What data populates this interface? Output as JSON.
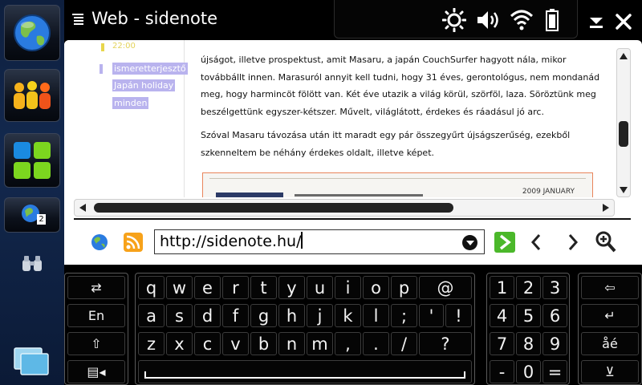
{
  "window": {
    "title": "Web - sidenote"
  },
  "sidebar": {
    "task_count": "2"
  },
  "content": {
    "cut_text": "22:00",
    "highlights": [
      "ismeretterjesztő",
      "Japán holiday",
      "minden"
    ],
    "paragraphs": [
      "újságot, illetve prospektust, amit Masaru, a japán CouchSurfer hagyott nála, mikor továbbállt innen. Marasuról annyit kell tudni, hogy 31 éves, gerontológus, nem mondanád meg, hogy harmincöt fölött van. Két éve utazik a világ körül, szörföl, laza. Söröztünk meg beszélgettünk egyszer-kétszer. Művelt, világlátott, érdekes és ráadásul jó arc.",
      "Szóval Masaru távozása után itt maradt egy pár összegyűrt újságszerűség, ezekből szkenneltem be néhány érdekes oldalt, illetve képet."
    ],
    "scan_date": "2009 JANUARY"
  },
  "urlbar": {
    "url": "http://sidenote.hu/"
  },
  "keyboard": {
    "left_keys": [
      "⇄",
      "En",
      "⇧",
      "▤◂"
    ],
    "letter_rows": [
      [
        "q",
        "w",
        "e",
        "r",
        "t",
        "y",
        "u",
        "i",
        "o",
        "p",
        "@"
      ],
      [
        "a",
        "s",
        "d",
        "f",
        "g",
        "h",
        "j",
        "k",
        "l",
        ";",
        "'",
        "!"
      ],
      [
        "z",
        "x",
        "c",
        "v",
        "b",
        "n",
        "m",
        ",",
        ".",
        "/",
        "?"
      ]
    ],
    "num_rows": [
      [
        "1",
        "2",
        "3"
      ],
      [
        "4",
        "5",
        "6"
      ],
      [
        "7",
        "8",
        "9"
      ],
      [
        "-",
        "0",
        "="
      ]
    ],
    "right_keys": [
      "⇦",
      "↵",
      "åé",
      "⊻"
    ]
  }
}
